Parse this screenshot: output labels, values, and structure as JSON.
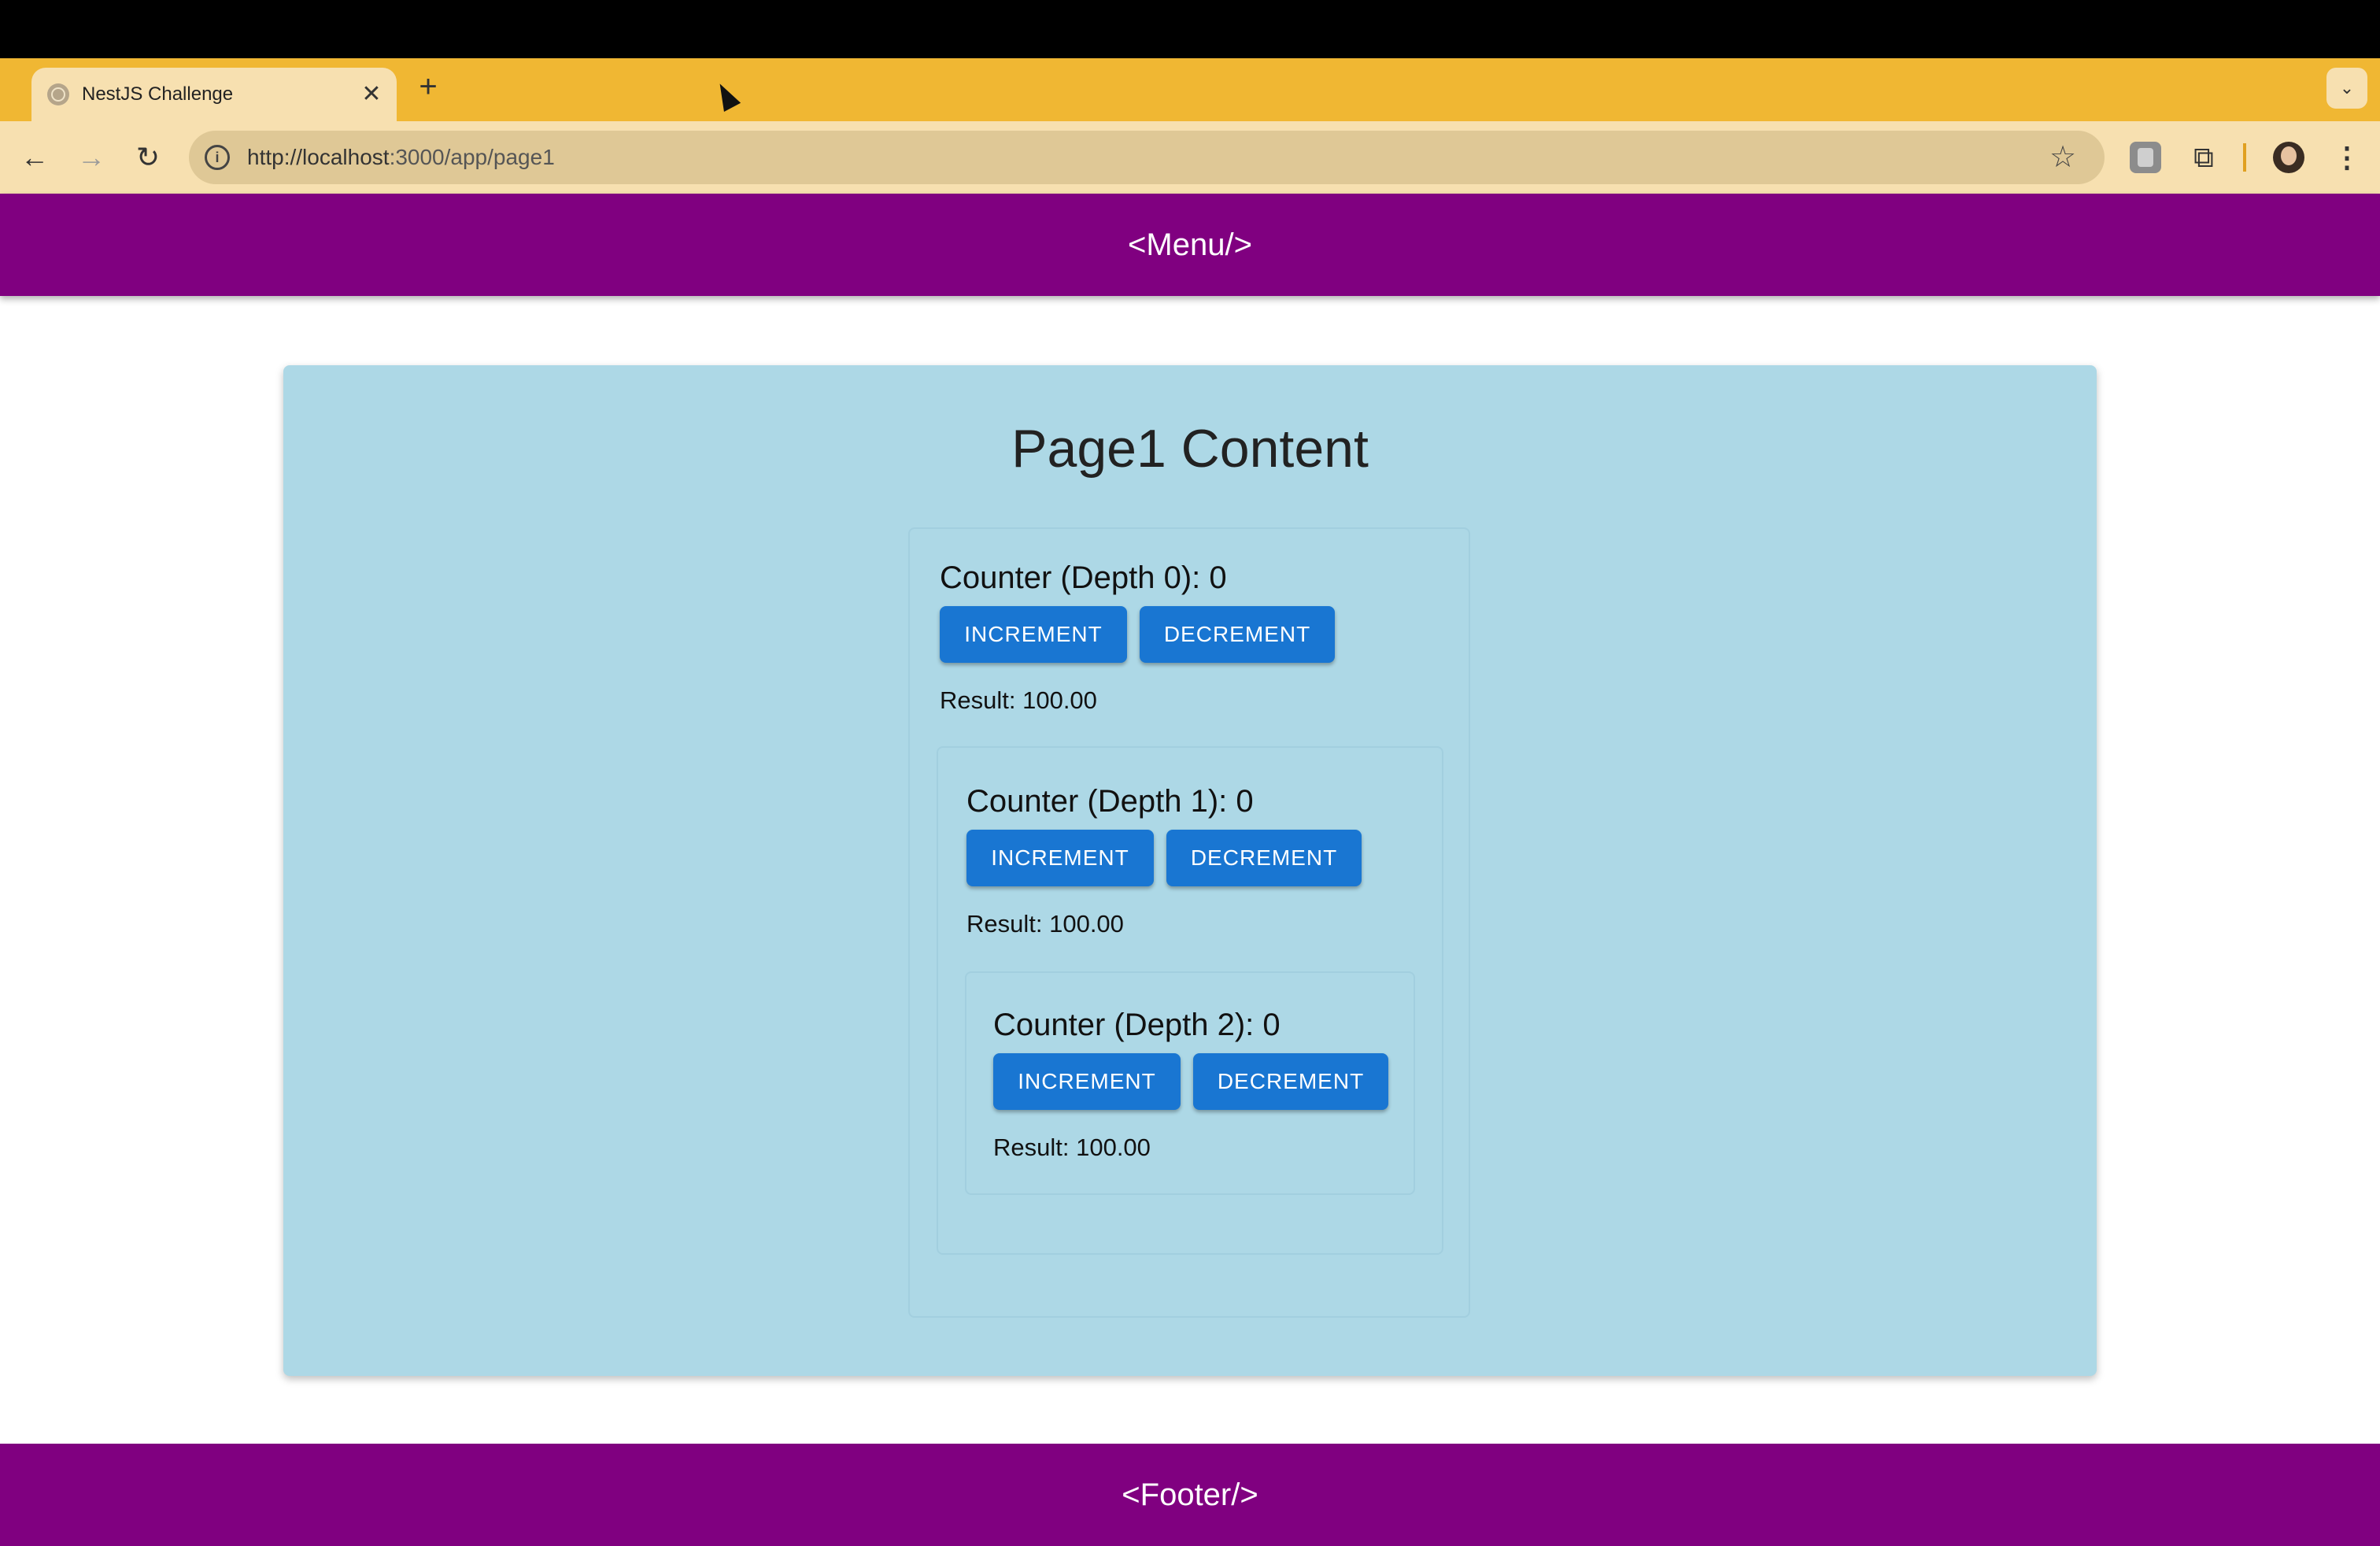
{
  "browser": {
    "tab_title": "NestJS Challenge",
    "tab_close": "✕",
    "new_tab": "+",
    "tab_menu": "⌄",
    "url_host": "http://localhost",
    "url_path": ":3000/app/page1",
    "back": "←",
    "forward": "→",
    "reload": "↻",
    "star": "☆",
    "extensions": "⧉",
    "menu": "⋮",
    "info": "i"
  },
  "header": {
    "menu_label": "<Menu/>"
  },
  "main": {
    "title": "Page1 Content",
    "counters": [
      {
        "title": "Counter (Depth 0): 0",
        "increment_label": "INCREMENT",
        "decrement_label": "DECREMENT",
        "result": "Result: 100.00"
      },
      {
        "title": "Counter (Depth 1): 0",
        "increment_label": "INCREMENT",
        "decrement_label": "DECREMENT",
        "result": "Result: 100.00"
      },
      {
        "title": "Counter (Depth 2): 0",
        "increment_label": "INCREMENT",
        "decrement_label": "DECREMENT",
        "result": "Result: 100.00"
      }
    ]
  },
  "footer": {
    "label": "<Footer/>"
  },
  "colors": {
    "tabstrip": "#f0b733",
    "toolbar": "#f7e0b0",
    "bar_purple": "#800080",
    "card_blue": "#add8e6",
    "button_blue": "#1976d2"
  }
}
